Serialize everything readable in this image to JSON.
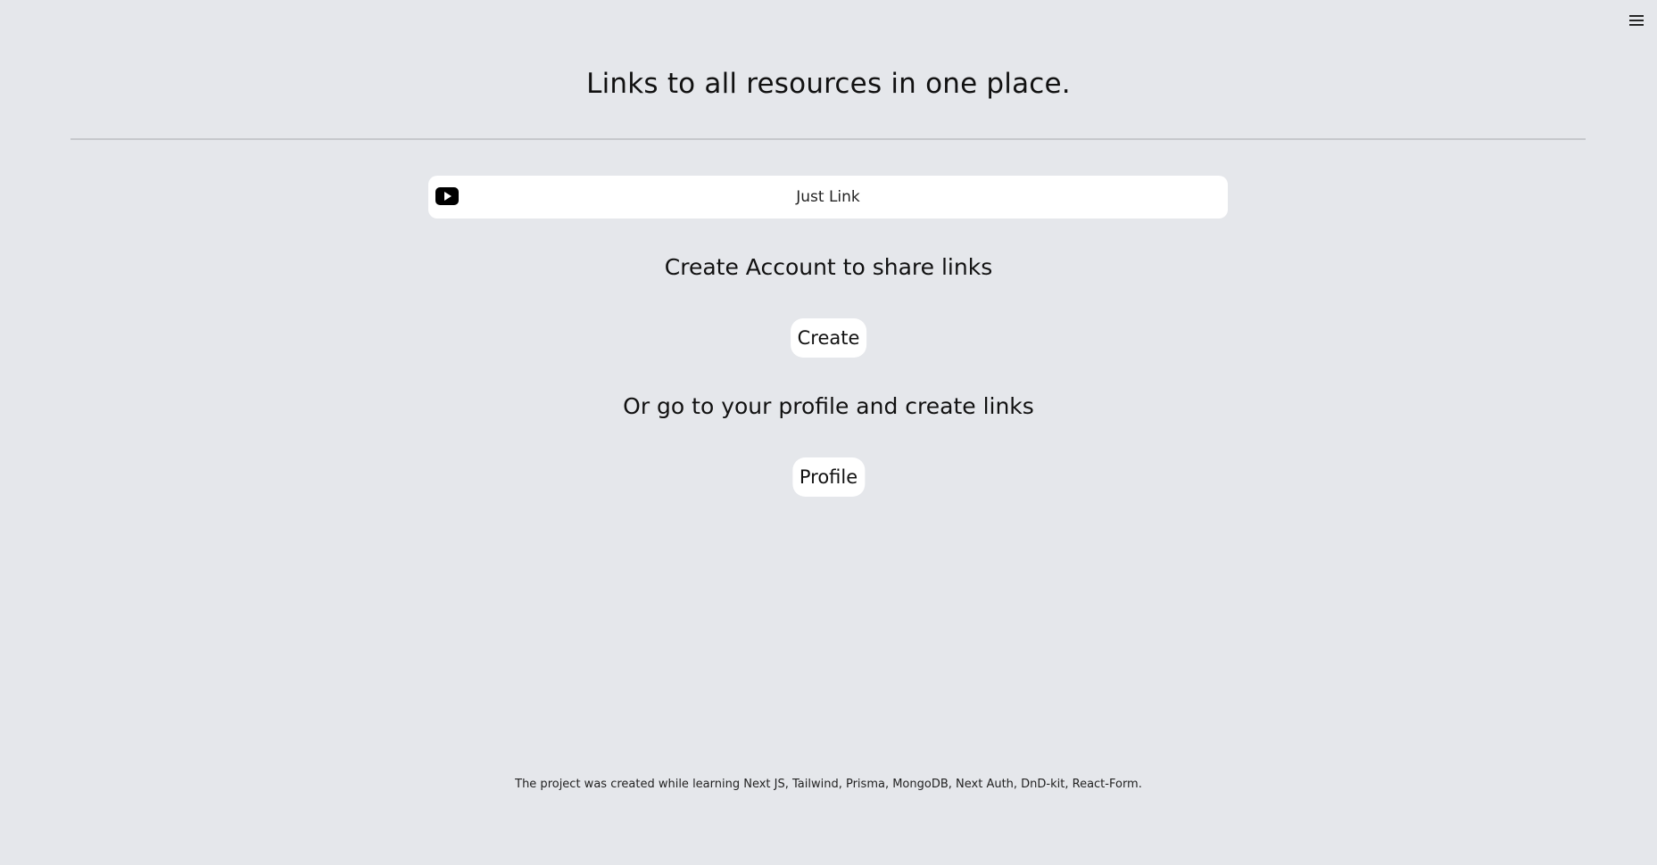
{
  "header": {
    "menu_icon": "hamburger-menu-icon",
    "title": "Links to all resources in one place."
  },
  "links": [
    {
      "icon": "youtube-icon",
      "label": "Just Link"
    }
  ],
  "cta": {
    "create_heading": "Create Account to share links",
    "create_button": "Create",
    "profile_heading": "Or go to your profile and create links",
    "profile_button": "Profile"
  },
  "footer": {
    "text": "The project was created while learning Next JS, Tailwind, Prisma, MongoDB, Next Auth, DnD-kit, React-Form."
  },
  "colors": {
    "background": "#e5e7eb",
    "card": "#ffffff",
    "text": "#111111",
    "divider": "#c6c8cc"
  }
}
